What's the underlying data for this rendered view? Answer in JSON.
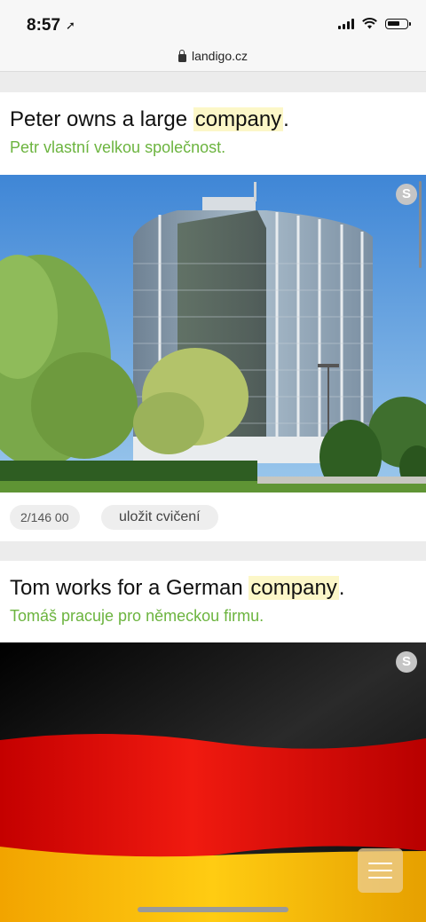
{
  "status_bar": {
    "time": "8:57"
  },
  "browser": {
    "url": "landigo.cz"
  },
  "cards": [
    {
      "sentence_before": "Peter owns a large ",
      "sentence_highlight": "company",
      "sentence_after": ".",
      "translation": "Petr vlastní velkou společnost.",
      "image_badge": "S"
    },
    {
      "sentence_before": "Tom works for a German ",
      "sentence_highlight": "company",
      "sentence_after": ".",
      "translation": "Tomáš pracuje pro německou firmu.",
      "image_badge": "S"
    }
  ],
  "meta": {
    "counter": "2/146 00",
    "save_label": "uložit cvičení"
  },
  "colors": {
    "translation": "#6cb43f",
    "highlight": "#fcf7c8",
    "flag_black": "#111111",
    "flag_red": "#dd0000",
    "flag_gold": "#ffce00"
  }
}
